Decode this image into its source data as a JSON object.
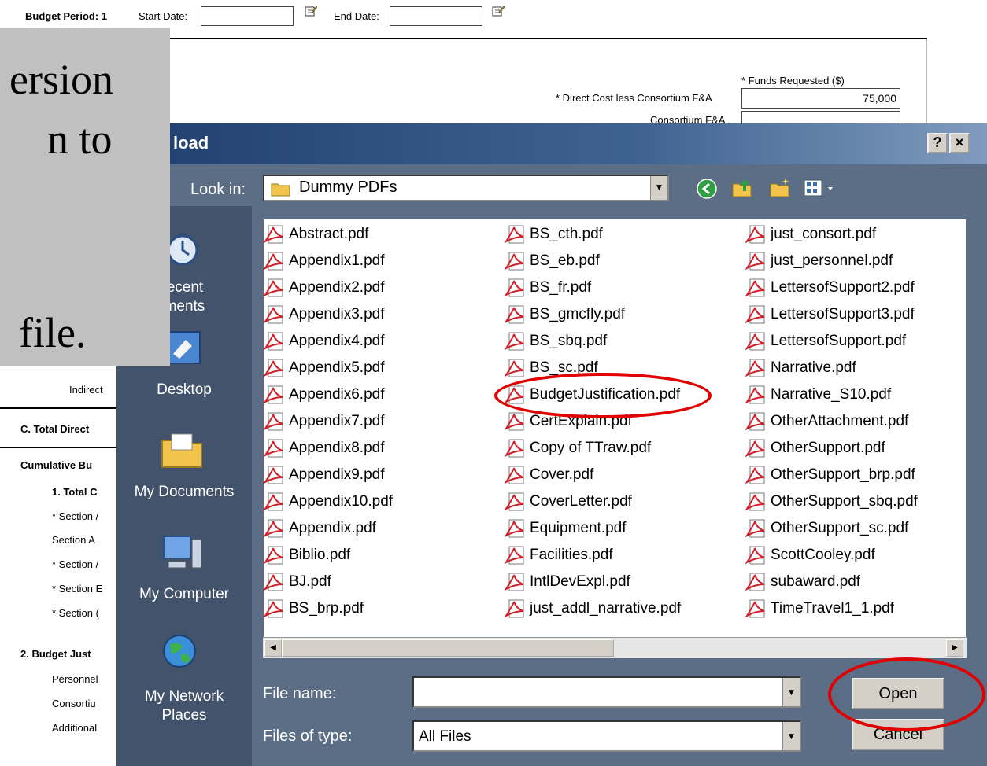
{
  "form": {
    "budget_period": "Budget Period: 1",
    "start_date_label": "Start Date:",
    "end_date_label": "End Date:",
    "funds_requested": "* Funds Requested ($)",
    "direct_cost_label": "* Direct Cost less Consortium F&A",
    "direct_cost_value": "75,000",
    "consortium_fa_label": "Consortium F&A",
    "indirect_label": "Indirect",
    "total_direct_label": "C. Total Direct",
    "cumulative_label": "Cumulative Bu",
    "total_label": "1. Total C",
    "section_a1": "* Section /",
    "section_a2": "Section A",
    "section_a3": "* Section /",
    "section_b": "* Section E",
    "section_c": "* Section (",
    "budget_just_label": "2. Budget Just",
    "personnel_label": "Personnel",
    "consortium_label": "Consortiu",
    "additional_label": "Additional"
  },
  "callout": {
    "line1": "ersion",
    "line2": "n to",
    "line3": "file."
  },
  "dialog": {
    "title": "load",
    "help_btn": "?",
    "close_btn": "×",
    "look_in_label": "Look in:",
    "look_in_value": "Dummy PDFs",
    "places": [
      "Recent\numents",
      "Desktop",
      "My Documents",
      "My Computer",
      "My Network\nPlaces"
    ],
    "files_col1": [
      "Abstract.pdf",
      "Appendix1.pdf",
      "Appendix2.pdf",
      "Appendix3.pdf",
      "Appendix4.pdf",
      "Appendix5.pdf",
      "Appendix6.pdf",
      "Appendix7.pdf",
      "Appendix8.pdf",
      "Appendix9.pdf",
      "Appendix10.pdf",
      "Appendix.pdf",
      "Biblio.pdf",
      "BJ.pdf",
      "BS_brp.pdf"
    ],
    "files_col2": [
      "BS_cth.pdf",
      "BS_eb.pdf",
      "BS_fr.pdf",
      "BS_gmcfly.pdf",
      "BS_sbq.pdf",
      "BS_sc.pdf",
      "BudgetJustification.pdf",
      "CertExplain.pdf",
      "Copy of TTraw.pdf",
      "Cover.pdf",
      "CoverLetter.pdf",
      "Equipment.pdf",
      "Facilities.pdf",
      "IntlDevExpl.pdf",
      "just_addl_narrative.pdf"
    ],
    "files_col3": [
      "just_consort.pdf",
      "just_personnel.pdf",
      "LettersofSupport2.pdf",
      "LettersofSupport3.pdf",
      "LettersofSupport.pdf",
      "Narrative.pdf",
      "Narrative_S10.pdf",
      "OtherAttachment.pdf",
      "OtherSupport.pdf",
      "OtherSupport_brp.pdf",
      "OtherSupport_sbq.pdf",
      "OtherSupport_sc.pdf",
      "ScottCooley.pdf",
      "subaward.pdf",
      "TimeTravel1_1.pdf"
    ],
    "file_name_label": "File name:",
    "file_name_value": "",
    "files_of_type_label": "Files of type:",
    "files_of_type_value": "All Files",
    "open_btn": "Open",
    "cancel_btn": "Cancel"
  },
  "colors": {
    "dialog_bg": "#5c6e86",
    "places_bg": "#43536b",
    "highlight_ring": "#e00000",
    "pdf_icon": "#d0202a"
  }
}
